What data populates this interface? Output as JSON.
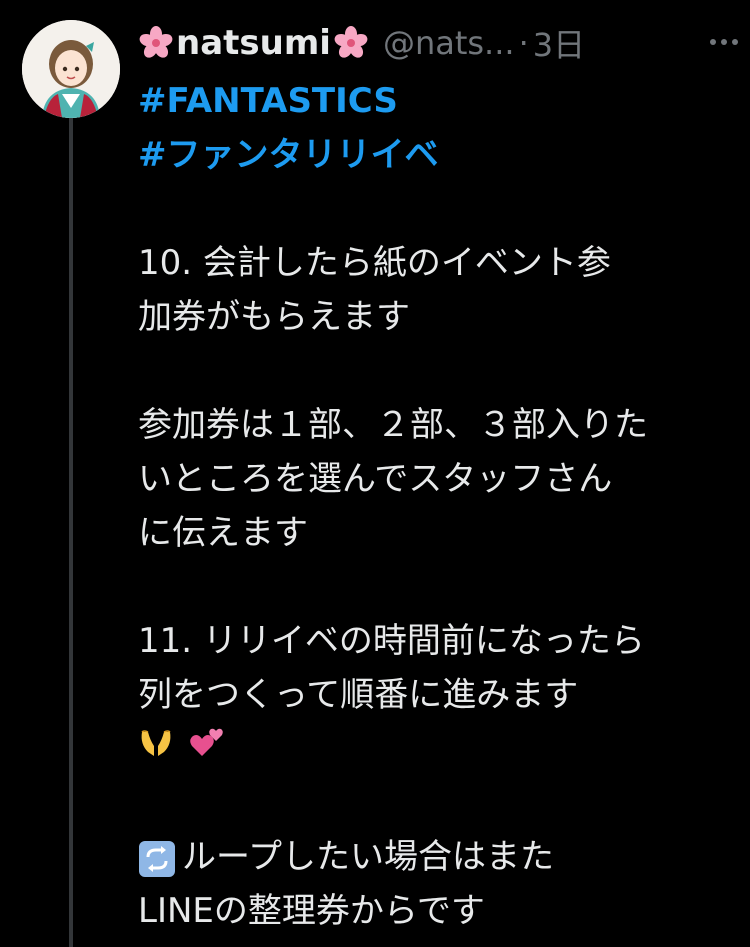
{
  "tweet": {
    "display_name": "natsumi",
    "handle": "@nats...",
    "separator": "·",
    "time": "3日",
    "hashtags": [
      "#FANTASTICS",
      "#ファンタリリイベ"
    ],
    "paragraph1": [
      "10. 会計したら紙のイベント参",
      "加券がもらえます"
    ],
    "paragraph2": [
      "参加券は１部、２部、３部入りた",
      "いところを選んでスタッフさん",
      "に伝えます"
    ],
    "paragraph3": [
      "11. リリイベの時間前になったら",
      "列をつくって順番に進みます"
    ],
    "paragraph4_line1": "ループしたい場合はまた",
    "paragraph4_line2": "LINEの整理券からです"
  },
  "icons": {
    "name_prefix": "cherry-blossom-icon",
    "name_suffix": "cherry-blossom-icon",
    "more": "more-options-icon",
    "emoji_1": "heart-hands-emoji",
    "emoji_2": "two-hearts-emoji",
    "loop": "repeat-arrows-emoji"
  },
  "colors": {
    "background": "#000000",
    "text": "#e7e9ea",
    "secondary": "#71767b",
    "hashtag": "#1d9bf0",
    "thread_line": "#333639"
  }
}
